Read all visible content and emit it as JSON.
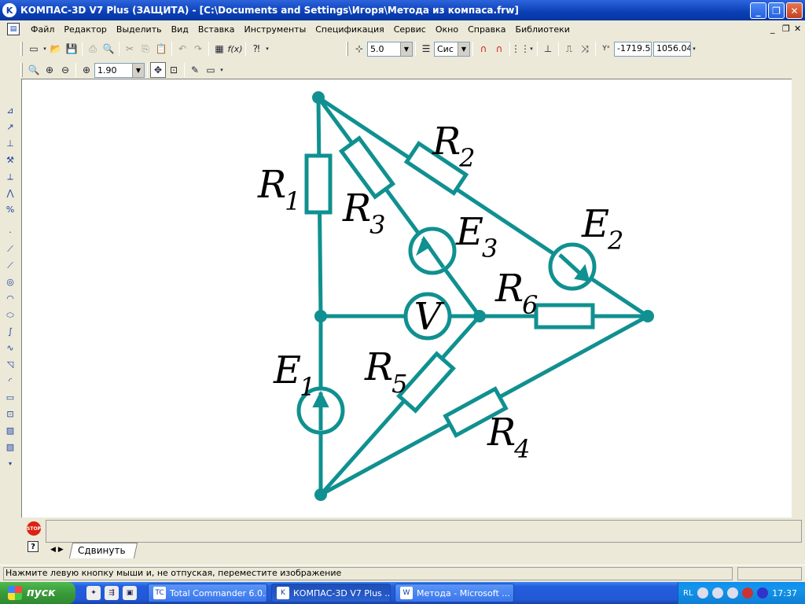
{
  "window": {
    "title": "КОМПАС-3D V7 Plus (ЗАЩИТА) - [C:\\Documents and Settings\\Игоря\\Метода из компаса.frw]",
    "app_icon": "kompas-logo-icon",
    "minimize": "_",
    "maximize": "❐",
    "close": "✕"
  },
  "menu": {
    "items": [
      "Файл",
      "Редактор",
      "Выделить",
      "Вид",
      "Вставка",
      "Инструменты",
      "Спецификация",
      "Сервис",
      "Окно",
      "Справка",
      "Библиотеки"
    ],
    "mdi_minimize": "_",
    "mdi_restore": "❐",
    "mdi_close": "✕"
  },
  "toolbar1": {
    "step_value": "5.0",
    "style_value": "Сис",
    "coord_x": "-1719.5",
    "coord_y": "1056.04"
  },
  "toolbar2": {
    "zoom_value": "1.90"
  },
  "drawing": {
    "labels": {
      "R1": {
        "main": "R",
        "sub": "1"
      },
      "R2": {
        "main": "R",
        "sub": "2"
      },
      "R3": {
        "main": "R",
        "sub": "3"
      },
      "R4": {
        "main": "R",
        "sub": "4"
      },
      "R5": {
        "main": "R",
        "sub": "5"
      },
      "R6": {
        "main": "R",
        "sub": "6"
      },
      "E1": {
        "main": "E",
        "sub": "1"
      },
      "E2": {
        "main": "E",
        "sub": "2"
      },
      "E3": {
        "main": "E",
        "sub": "3"
      },
      "V": "V"
    },
    "wire_color": "#109090"
  },
  "bottom": {
    "stop_label": "STOP",
    "help_label": "?",
    "tab_label": "Сдвинуть"
  },
  "status": {
    "text": "Нажмите левую кнопку мыши и, не отпуская, переместите изображение"
  },
  "taskbar": {
    "start_label": "пуск",
    "buttons": [
      {
        "label": "Total Commander 6.0...",
        "icon": "total-commander-icon",
        "active": false
      },
      {
        "label": "КОМПАС-3D V7 Plus ...",
        "icon": "kompas-icon",
        "active": true
      },
      {
        "label": "Метода - Microsoft ...",
        "icon": "word-icon",
        "active": false
      }
    ],
    "lang": "RL",
    "clock": "17:37"
  }
}
